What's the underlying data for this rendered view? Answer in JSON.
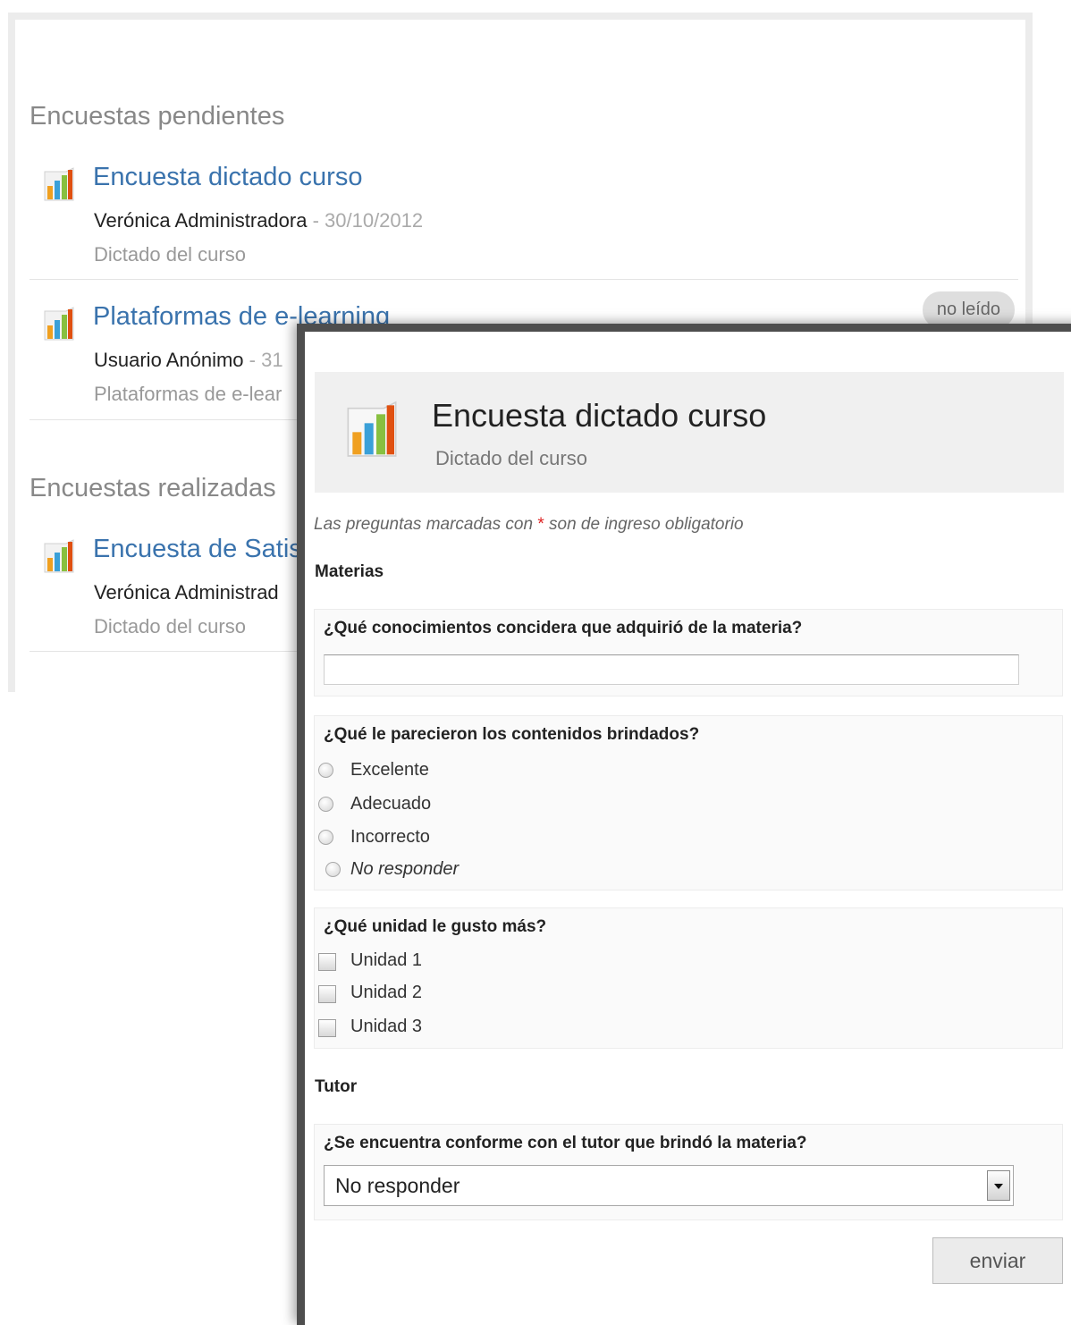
{
  "pending": {
    "heading": "Encuestas pendientes",
    "items": [
      {
        "title": "Encuesta dictado curso",
        "author": "Verónica Administradora",
        "date": " - 30/10/2012",
        "description": "Dictado del curso",
        "badge": ""
      },
      {
        "title": "Plataformas de e-learning",
        "author": "Usuario Anónimo",
        "date": " - 31",
        "description": "Plataformas de e-lear",
        "badge": "no leído"
      }
    ]
  },
  "completed": {
    "heading": "Encuestas realizadas",
    "items": [
      {
        "title": "Encuesta de Satis",
        "author": "Verónica Administrad",
        "description": "Dictado del curso"
      }
    ]
  },
  "form": {
    "title": "Encuesta dictado curso",
    "subtitle": "Dictado del curso",
    "required_note_before": "Las preguntas marcadas con",
    "required_star": "*",
    "required_note_after": "son de ingreso obligatorio",
    "group1_title": "Materias",
    "q1": {
      "label": "¿Qué conocimientos concidera que adquirió de la materia?",
      "value": ""
    },
    "q2": {
      "label": "¿Qué le parecieron los contenidos brindados?",
      "options": [
        "Excelente",
        "Adecuado",
        "Incorrecto",
        "No responder"
      ]
    },
    "q3": {
      "label": "¿Qué unidad le gusto más?",
      "options": [
        "Unidad 1",
        "Unidad 2",
        "Unidad 3"
      ]
    },
    "group2_title": "Tutor",
    "q4": {
      "label": "¿Se encuentra conforme con el tutor que brindó la materia?",
      "selected": "No responder"
    },
    "submit_label": "enviar"
  },
  "colors": {
    "link": "#3a73ad",
    "badge_bg": "#dedede",
    "required_star": "#dd2222",
    "window_border": "#4e4e4e"
  },
  "icons": {
    "survey": "bar-chart-icon"
  }
}
